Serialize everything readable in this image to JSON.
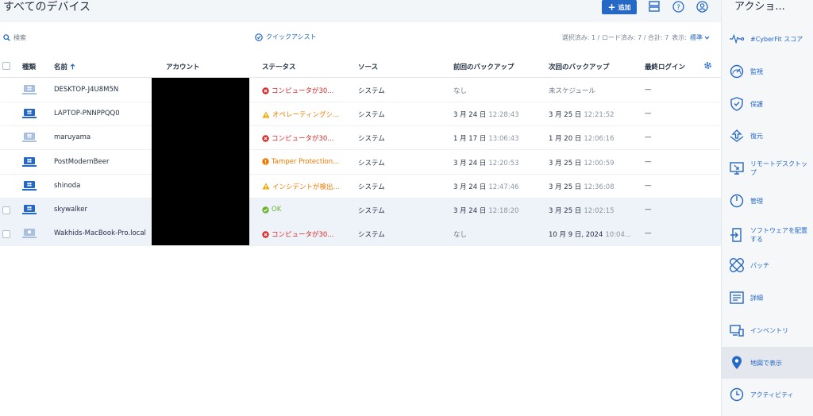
{
  "header": {
    "title": "すべてのデバイス",
    "add_label": "追加"
  },
  "toolbar": {
    "search_placeholder": "検索",
    "quick_assist": "クイックアシスト",
    "selection_info": "選択済み: 1 / ロード済み: 7 / 合計: 7",
    "view_label": "表示:",
    "view_value": "標準"
  },
  "columns": {
    "type": "種類",
    "name": "名前",
    "account": "アカウント",
    "status": "ステータス",
    "source": "ソース",
    "last_backup": "前回のバックアップ",
    "next_backup": "次回のバックアップ",
    "last_login": "最終ログイン"
  },
  "rows": [
    {
      "name": "DESKTOP-J4U8M5N",
      "status": "コンピュータが30...",
      "status_kind": "error",
      "source": "システム",
      "last_date": "なし",
      "last_time": "",
      "next_date": "未スケジュール",
      "next_time": "",
      "login": "—",
      "checkbox": false,
      "selected": false
    },
    {
      "name": "LAPTOP-PNNPPQQ0",
      "status": "オペレーティングシ...",
      "status_kind": "warning",
      "source": "システム",
      "last_date": "3 月 24 日",
      "last_time": "12:28:43",
      "next_date": "3 月 25 日",
      "next_time": "12:21:52",
      "login": "—",
      "checkbox": false,
      "selected": false
    },
    {
      "name": "maruyama",
      "status": "コンピュータが30...",
      "status_kind": "error",
      "source": "システム",
      "last_date": "1 月 17 日",
      "last_time": "13:06:43",
      "next_date": "1 月 20 日",
      "next_time": "12:06:16",
      "login": "—",
      "checkbox": false,
      "selected": false
    },
    {
      "name": "PostModernBeer",
      "status": "Tamper Protection...",
      "status_kind": "alert",
      "source": "システム",
      "last_date": "3 月 24 日",
      "last_time": "12:20:53",
      "next_date": "3 月 25 日",
      "next_time": "12:00:59",
      "login": "—",
      "checkbox": false,
      "selected": false
    },
    {
      "name": "shinoda",
      "status": "インシデントが検出...",
      "status_kind": "warning",
      "source": "システム",
      "last_date": "3 月 24 日",
      "last_time": "12:47:46",
      "next_date": "3 月 25 日",
      "next_time": "12:36:08",
      "login": "—",
      "checkbox": false,
      "selected": false
    },
    {
      "name": "skywalker",
      "status": "OK",
      "status_kind": "ok",
      "source": "システム",
      "last_date": "3 月 24 日",
      "last_time": "12:18:20",
      "next_date": "3 月 25 日",
      "next_time": "12:02:15",
      "login": "—",
      "checkbox": true,
      "selected": true
    },
    {
      "name": "Wakhids-MacBook-Pro.local",
      "status": "コンピュータが30...",
      "status_kind": "error",
      "source": "システム",
      "last_date": "なし",
      "last_time": "",
      "next_date": "10 月 9 日, 2024",
      "next_time": "10:04...",
      "login": "—",
      "checkbox": true,
      "selected": true
    }
  ],
  "sidebar": {
    "title": "アクショ...",
    "items": [
      {
        "label": "#CyberFit スコア",
        "icon": "pulse-icon"
      },
      {
        "label": "監視",
        "icon": "gauge-icon"
      },
      {
        "label": "保護",
        "icon": "shield-icon"
      },
      {
        "label": "復元",
        "icon": "restore-icon"
      },
      {
        "label": "リモートデスクトップ",
        "icon": "remote-desktop-icon"
      },
      {
        "label": "管理",
        "icon": "power-icon"
      },
      {
        "label": "ソフトウェアを配置する",
        "icon": "deploy-icon"
      },
      {
        "label": "パッチ",
        "icon": "patch-icon"
      },
      {
        "label": "詳細",
        "icon": "details-icon"
      },
      {
        "label": "インベントリ",
        "icon": "inventory-icon"
      },
      {
        "label": "地図で表示",
        "icon": "map-pin-icon"
      },
      {
        "label": "アクティビティ",
        "icon": "clock-icon"
      }
    ]
  },
  "colors": {
    "accent": "#2668c5",
    "error": "#d62b2b",
    "warning": "#f0a500",
    "alert": "#f07a00",
    "ok": "#6bb32e"
  }
}
